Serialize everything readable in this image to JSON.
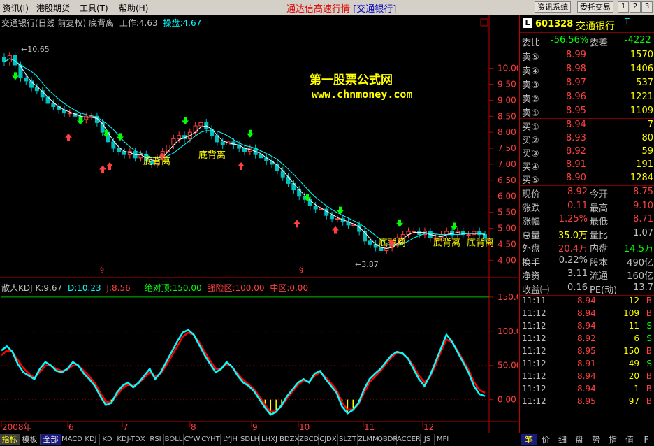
{
  "menu": {
    "items": [
      "资讯(I)",
      "港股期货",
      "工具(T)",
      "帮助(H)"
    ],
    "app_title": "通达信高速行情",
    "app_subtitle": "[交通银行]",
    "sys_buttons": [
      "资讯系统",
      "委托交易"
    ],
    "win_buttons": [
      "1",
      "2",
      "3"
    ]
  },
  "chart_header": {
    "stock": "交通银行(日线 前复权)",
    "formula": "底背离",
    "work_label": "工作:4.63",
    "op_label": "操盘:4.67"
  },
  "watermark": {
    "line1": "第一股票公式网",
    "line2": "www.chnmoney.com"
  },
  "price_annotations": {
    "high": "10.65",
    "low": "3.87",
    "div_label": "底背离",
    "section_marks": [
      "§",
      "§"
    ]
  },
  "kdj_header": {
    "name": "散人KDJ",
    "k": "K:9.67",
    "d": "D:10.23",
    "j": "J:8.56",
    "top": "绝对顶:150.00",
    "strong": "强险区:100.00",
    "mid": "中区:0.00"
  },
  "months": [
    "2008年",
    "6",
    "7",
    "8",
    "9",
    "10",
    "11",
    "12"
  ],
  "chart_data": {
    "type": "line",
    "price_axis": [
      "10.00",
      "9.50",
      "9.00",
      "8.50",
      "8.00",
      "7.50",
      "7.00",
      "6.50",
      "6.00",
      "5.50",
      "5.00",
      "4.50",
      "4.00"
    ],
    "price_ylim": [
      3.7,
      10.8
    ],
    "kdj_axis": [
      "150.0",
      "100.0",
      "50.00",
      "0.00"
    ],
    "kdj_ylim": [
      -30,
      155
    ],
    "price_series": [
      10.2,
      10.4,
      10.1,
      9.7,
      9.6,
      9.4,
      9.3,
      9.1,
      8.9,
      8.8,
      8.7,
      8.6,
      8.6,
      8.5,
      8.4,
      8.5,
      8.5,
      8.3,
      8.0,
      7.7,
      7.5,
      7.4,
      7.3,
      7.4,
      7.2,
      7.3,
      7.1,
      7.0,
      7.2,
      7.4,
      7.6,
      7.8,
      7.9,
      7.8,
      8.0,
      8.2,
      8.3,
      8.1,
      7.9,
      7.7,
      7.6,
      7.7,
      7.6,
      7.5,
      7.4,
      7.5,
      7.3,
      7.2,
      7.1,
      7.0,
      6.8,
      6.6,
      6.4,
      6.2,
      6.0,
      5.9,
      5.7,
      5.6,
      5.6,
      5.4,
      5.3,
      5.3,
      5.2,
      5.1,
      5.1,
      4.9,
      4.6,
      4.5,
      4.4,
      4.3,
      4.4,
      4.5,
      4.7,
      4.8,
      4.9,
      4.9,
      4.8,
      4.9,
      4.7,
      4.7,
      4.8,
      4.9,
      4.8,
      4.9,
      4.8,
      4.8,
      4.9,
      4.8,
      4.7
    ],
    "k_series": [
      72,
      78,
      70,
      52,
      40,
      35,
      30,
      45,
      55,
      50,
      42,
      40,
      45,
      55,
      50,
      38,
      30,
      20,
      5,
      -8,
      -5,
      10,
      20,
      25,
      18,
      25,
      35,
      45,
      30,
      40,
      55,
      70,
      85,
      98,
      102,
      95,
      80,
      65,
      52,
      40,
      45,
      55,
      48,
      35,
      25,
      20,
      12,
      0,
      -12,
      -22,
      -18,
      -8,
      5,
      15,
      25,
      30,
      25,
      38,
      42,
      30,
      20,
      10,
      -10,
      -20,
      -15,
      -5,
      15,
      30,
      38,
      45,
      55,
      65,
      70,
      68,
      60,
      45,
      30,
      20,
      35,
      55,
      75,
      95,
      85,
      70,
      55,
      40,
      20,
      8,
      5
    ],
    "d_series": [
      65,
      72,
      70,
      58,
      46,
      38,
      32,
      40,
      50,
      50,
      45,
      42,
      44,
      50,
      50,
      42,
      34,
      24,
      10,
      -3,
      -4,
      6,
      16,
      22,
      20,
      24,
      32,
      40,
      34,
      38,
      50,
      64,
      78,
      92,
      98,
      95,
      84,
      70,
      57,
      45,
      45,
      52,
      48,
      38,
      29,
      22,
      15,
      4,
      -8,
      -18,
      -17,
      -10,
      2,
      12,
      22,
      28,
      26,
      35,
      40,
      33,
      24,
      14,
      -4,
      -15,
      -14,
      -7,
      10,
      25,
      34,
      42,
      52,
      62,
      68,
      67,
      61,
      49,
      35,
      25,
      33,
      50,
      70,
      88,
      84,
      72,
      58,
      44,
      26,
      14,
      10
    ]
  },
  "quote": {
    "code": "601328",
    "name": "交通银行",
    "weibi_label": "委比",
    "weibi": "-56.56%",
    "weicha_label": "委差",
    "weicha": "-4222",
    "asks": [
      {
        "label": "卖⑤",
        "price": "8.99",
        "vol": "1570"
      },
      {
        "label": "卖④",
        "price": "8.98",
        "vol": "1406"
      },
      {
        "label": "卖③",
        "price": "8.97",
        "vol": "537"
      },
      {
        "label": "卖②",
        "price": "8.96",
        "vol": "1221"
      },
      {
        "label": "卖①",
        "price": "8.95",
        "vol": "1109"
      }
    ],
    "bids": [
      {
        "label": "买①",
        "price": "8.94",
        "vol": "7"
      },
      {
        "label": "买②",
        "price": "8.93",
        "vol": "80"
      },
      {
        "label": "买③",
        "price": "8.92",
        "vol": "59"
      },
      {
        "label": "买④",
        "price": "8.91",
        "vol": "191"
      },
      {
        "label": "买⑤",
        "price": "8.90",
        "vol": "1284"
      }
    ],
    "stats": [
      {
        "l1": "现价",
        "v1": "8.92",
        "l2": "今开",
        "v2": "8.75"
      },
      {
        "l1": "涨跌",
        "v1": "0.11",
        "l2": "最高",
        "v2": "9.10"
      },
      {
        "l1": "涨幅",
        "v1": "1.25%",
        "l2": "最低",
        "v2": "8.71"
      },
      {
        "l1": "总量",
        "v1": "35.0万",
        "l2": "量比",
        "v2": "1.07"
      },
      {
        "l1": "外盘",
        "v1": "20.4万",
        "l2": "内盘",
        "v2": "14.5万"
      },
      {
        "l1": "换手",
        "v1": "0.22%",
        "l2": "股本",
        "v2": "490亿"
      },
      {
        "l1": "净资",
        "v1": "3.11",
        "l2": "流通",
        "v2": "160亿"
      },
      {
        "l1": "收益㈠",
        "v1": "0.16",
        "l2": "PE(动)",
        "v2": "13.7"
      }
    ],
    "ticks": [
      {
        "t": "11:11",
        "p": "8.94",
        "v": "12",
        "s": "B"
      },
      {
        "t": "11:12",
        "p": "8.94",
        "v": "109",
        "s": "B"
      },
      {
        "t": "11:12",
        "p": "8.94",
        "v": "11",
        "s": "S"
      },
      {
        "t": "11:12",
        "p": "8.92",
        "v": "6",
        "s": "S"
      },
      {
        "t": "11:12",
        "p": "8.95",
        "v": "150",
        "s": "B"
      },
      {
        "t": "11:12",
        "p": "8.91",
        "v": "49",
        "s": "S"
      },
      {
        "t": "11:12",
        "p": "8.94",
        "v": "20",
        "s": "B"
      },
      {
        "t": "11:12",
        "p": "8.94",
        "v": "1",
        "s": "B"
      },
      {
        "t": "11:12",
        "p": "8.95",
        "v": "97",
        "s": "B"
      }
    ]
  },
  "bottom_tabs": [
    "指标",
    "模板",
    "全部",
    "MACD",
    "KDJ",
    "KD",
    "KDJ-TDX",
    "RSI",
    "BOLL",
    "CYW",
    "CYHT",
    "LYJH",
    "SDLH",
    "LHXJ",
    "BDZX",
    "ZBCD",
    "CJDX",
    "SLZT",
    "ZLMM",
    "QBDR",
    "ACCER",
    "JS",
    "MFI"
  ],
  "right_tabs": [
    "笔",
    "价",
    "细",
    "盘",
    "势",
    "指",
    "值",
    "F"
  ],
  "colors": {
    "up": "#ff4040",
    "down": "#00c0c0",
    "k_line": "#00ffff",
    "d_line": "#ff0000",
    "accent": "#ffff00"
  }
}
